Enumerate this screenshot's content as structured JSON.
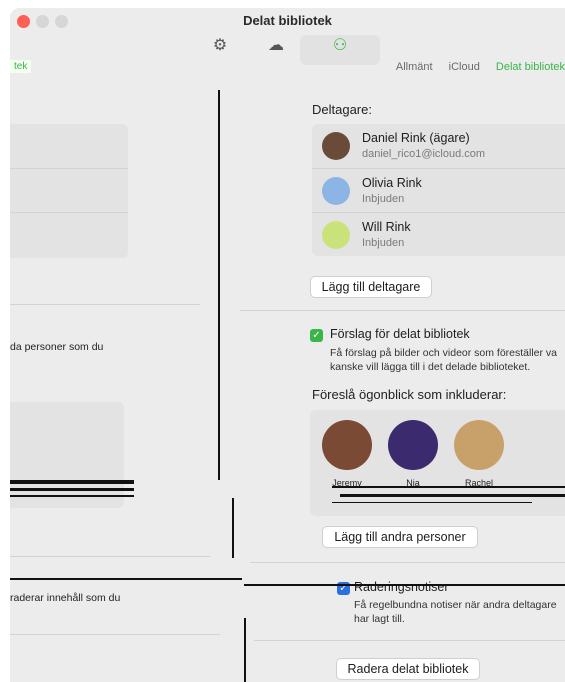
{
  "window": {
    "title": "Delat bibliotek"
  },
  "toolbar": {
    "tabs": [
      {
        "label": "Allmänt",
        "icon": "gear-icon"
      },
      {
        "label": "iCloud",
        "icon": "cloud-icon"
      },
      {
        "label": "Delat bibliotek",
        "icon": "people-icon",
        "active": true
      }
    ],
    "partial_left_label": "tek"
  },
  "left_pane": {
    "text_1": "da personer som du",
    "text_2": "raderar innehåll som du"
  },
  "participants": {
    "heading": "Deltagare:",
    "items": [
      {
        "name": "Daniel Rink (ägare)",
        "sub": "daniel_rico1@icloud.com"
      },
      {
        "name": "Olivia Rink",
        "sub": "Inbjuden"
      },
      {
        "name": "Will Rink",
        "sub": "Inbjuden"
      }
    ],
    "add_button": "Lägg till deltagare"
  },
  "suggestions": {
    "checkbox_label": "Förslag för delat bibliotek",
    "checked": true,
    "description": "Få förslag på bilder och videor som föreställer va kanske vill lägga till i det delade biblioteket."
  },
  "moments": {
    "heading": "Föreslå ögonblick som inkluderar:",
    "people": [
      {
        "name": "Jeremy"
      },
      {
        "name": "Nia"
      },
      {
        "name": "Rachel"
      }
    ],
    "add_button": "Lägg till andra personer"
  },
  "notices": {
    "checkbox_label": "Raderingsnotiser",
    "checked": true,
    "description": "Få regelbundna notiser när andra deltagare har lagt till."
  },
  "delete_button": "Radera delat bibliotek",
  "colors": {
    "accent_green": "#39b54a",
    "checkbox_blue": "#2a70e0",
    "close_red": "#fe5f57"
  }
}
